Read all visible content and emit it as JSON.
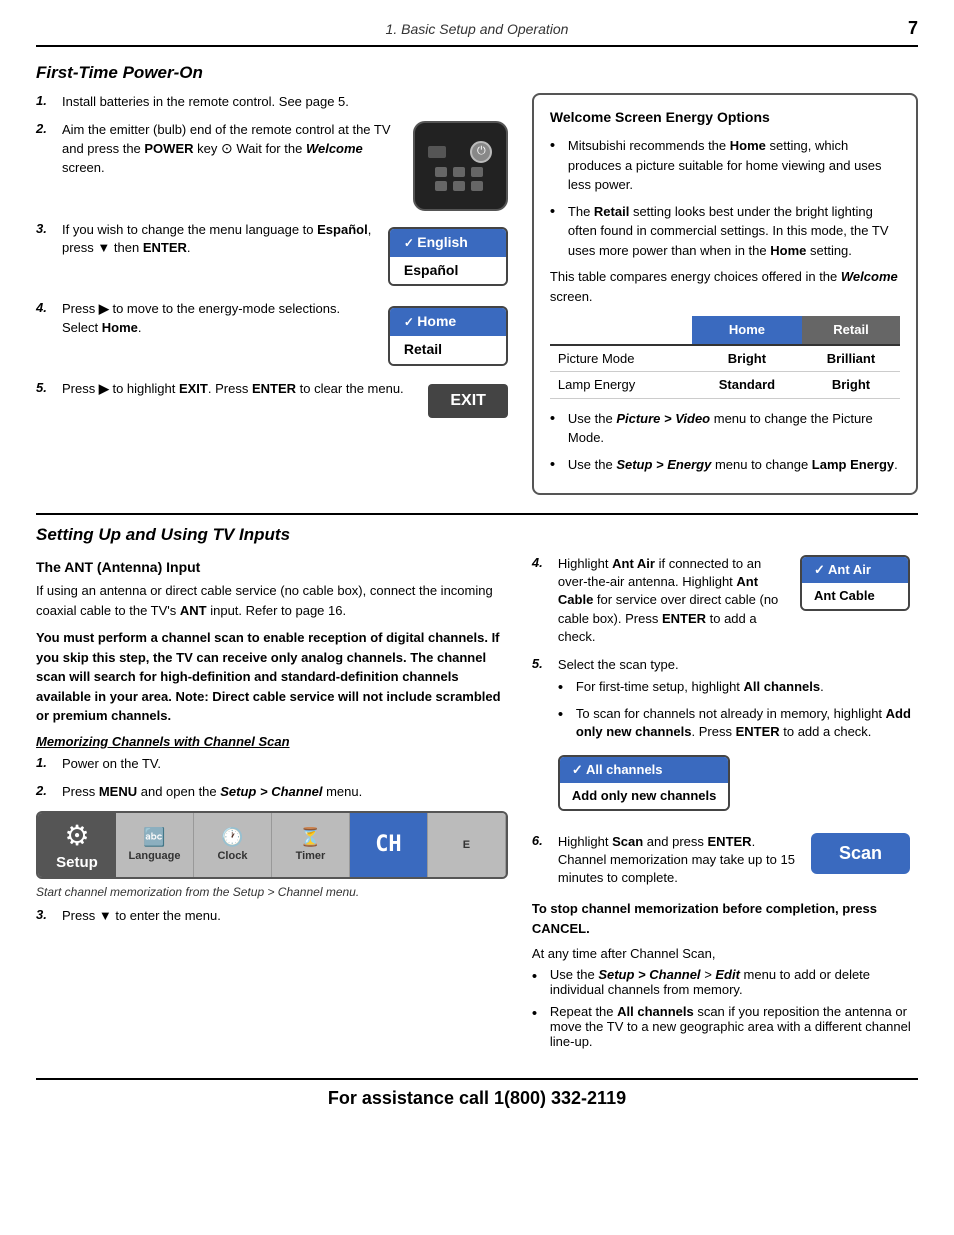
{
  "header": {
    "title": "1.  Basic Setup and Operation",
    "page_number": "7"
  },
  "section1": {
    "title": "First-Time Power-On",
    "steps": [
      {
        "num": "1.",
        "text": "Install batteries in the remote control.  See page 5."
      },
      {
        "num": "2.",
        "text_parts": [
          "Aim the emitter (bulb) end of the remote control at the TV and press the ",
          "POWER",
          " key ",
          "  Wait for the ",
          "Welcome",
          " screen."
        ]
      },
      {
        "num": "3.",
        "text_parts": [
          "If you wish to change the menu language to ",
          "Español",
          ", press ",
          "▼",
          " then ",
          "ENTER",
          "."
        ]
      },
      {
        "num": "4.",
        "text_parts": [
          "Press ",
          "▶",
          " to move to the energy-mode selections. Select ",
          "Home",
          "."
        ]
      },
      {
        "num": "5.",
        "text_parts": [
          "Press ",
          "▶",
          " to highlight ",
          "EXIT",
          ". Press ",
          "ENTER",
          " to clear the menu."
        ]
      }
    ],
    "language_menu": {
      "english": "English",
      "espanol": "Español"
    },
    "mode_menu": {
      "home": "Home",
      "retail": "Retail"
    },
    "exit_btn": "EXIT"
  },
  "welcome_box": {
    "title": "Welcome Screen Energy Options",
    "bullets": [
      "Mitsubishi recommends the Home setting, which produces a picture suitable for home viewing and uses less power.",
      "The Retail setting looks best under the bright lighting often found in commercial settings.  In this mode, the TV uses more power than when in the Home setting."
    ],
    "compare_text": "This table compares energy choices offered in the Welcome screen.",
    "table": {
      "headers": [
        "",
        "Home",
        "Retail"
      ],
      "rows": [
        [
          "Picture Mode",
          "Bright",
          "Brilliant"
        ],
        [
          "Lamp Energy",
          "Standard",
          "Bright"
        ]
      ]
    },
    "footer_bullets": [
      "Use the Picture > Video menu to change the Picture Mode.",
      "Use the Setup > Energy menu to change Lamp Energy."
    ]
  },
  "section2": {
    "title": "Setting Up and Using TV Inputs",
    "subsection": "The ANT (Antenna) Input",
    "intro": "If using an antenna or direct cable service (no cable box), connect the incoming coaxial cable to the TV's ANT input.  Refer to page 16.",
    "warning": "You must perform a channel scan to enable reception of digital channels.  If you skip this step, the TV can receive only analog channels. The channel scan will search for high-definition and standard-definition channels available in your area.  Note:  Direct cable service will not include scrambled or premium channels.",
    "memorizing_title": "Memorizing Channels with Channel Scan",
    "left_steps": [
      {
        "num": "1.",
        "text": "Power on the TV."
      },
      {
        "num": "2.",
        "text_parts": [
          "Press ",
          "MENU",
          " and open the ",
          "Setup > Channel",
          " menu."
        ]
      },
      {
        "num": "3.",
        "text": "Press ▼ to enter the menu."
      }
    ],
    "setup_menu_caption": "Start channel memorization from the Setup > Channel menu.",
    "setup_menu": {
      "tabs": [
        "Language",
        "Clock",
        "Timer",
        "Channel",
        "E"
      ]
    },
    "right_steps": [
      {
        "num": "4.",
        "text_parts": [
          "Highlight ",
          "Ant Air",
          " if connected to an over-the-air antenna.  Highlight ",
          "Ant Cable",
          " for service over direct cable (no cable box).  Press ",
          "ENTER",
          " to add a check."
        ]
      },
      {
        "num": "5.",
        "sub_text": "Select the scan type.",
        "bullets": [
          "For first-time setup, highlight All channels.",
          "To scan for channels not already in memory, highlight Add only new channels.  Press ENTER to add a check."
        ]
      },
      {
        "num": "6.",
        "text_parts": [
          "Highlight ",
          "Scan",
          " and press ",
          "ENTER",
          ". Channel memorization may take up to 15 minutes to complete."
        ]
      }
    ],
    "ant_menu": {
      "ant_air": "Ant Air",
      "ant_cable": "Ant Cable"
    },
    "channels_menu": {
      "all": "All channels",
      "new": "Add only new channels"
    },
    "scan_btn": "Scan",
    "stop_text": "To stop channel memorization before completion, press CANCEL.",
    "after_scan_text": "At any time after Channel Scan,",
    "after_scan_bullets": [
      "Use the Setup > Channel > Edit menu to add or delete individual channels from memory.",
      "Repeat the All channels scan if you reposition the antenna or move the TV to a new geographic area with a different channel line-up."
    ]
  },
  "footer": {
    "text": "For assistance call 1(800) 332-2119"
  }
}
